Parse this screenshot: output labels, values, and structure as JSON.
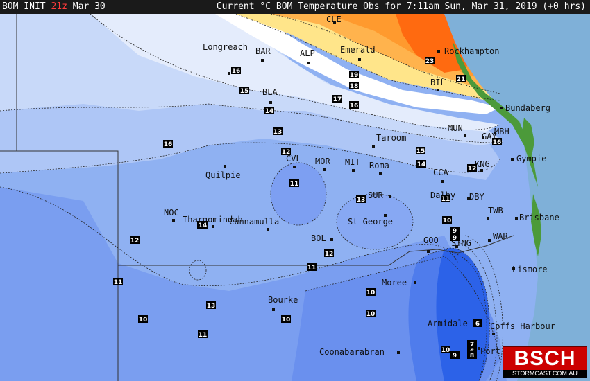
{
  "header": {
    "init_prefix": "BOM INIT",
    "init_time": "21z",
    "init_date": "Mar 30",
    "title": "Current °C BOM Temperature Obs for 7:11am Sun, Mar 31, 2019 (+0 hrs)"
  },
  "logo": {
    "name": "BSCH",
    "url": "STORMCAST.COM.AU"
  },
  "colors": {
    "ocean": "#7fb0d8",
    "land_green": "#4c9a3a",
    "warm_orange": "#ff7a1a",
    "cold_blue": "#2c62e8"
  },
  "towns": [
    {
      "name": "Longreach"
    },
    {
      "name": "BAR"
    },
    {
      "name": "ALP"
    },
    {
      "name": "CLE"
    },
    {
      "name": "Emerald"
    },
    {
      "name": "Rockhampton"
    },
    {
      "name": "BIL"
    },
    {
      "name": "BLA"
    },
    {
      "name": "Bundaberg"
    },
    {
      "name": "Taroom"
    },
    {
      "name": "MUN"
    },
    {
      "name": "GAY"
    },
    {
      "name": "MBH"
    },
    {
      "name": "Gympie"
    },
    {
      "name": "Quilpie"
    },
    {
      "name": "CVL"
    },
    {
      "name": "MOR"
    },
    {
      "name": "MIT"
    },
    {
      "name": "Roma"
    },
    {
      "name": "CCA"
    },
    {
      "name": "KNG"
    },
    {
      "name": "SUR"
    },
    {
      "name": "Dalby"
    },
    {
      "name": "DBY"
    },
    {
      "name": "NOC"
    },
    {
      "name": "Thargomindah"
    },
    {
      "name": "Cunnamulla"
    },
    {
      "name": "St George"
    },
    {
      "name": "TWB"
    },
    {
      "name": "Brisbane"
    },
    {
      "name": "BOL"
    },
    {
      "name": "GOO"
    },
    {
      "name": "STNG"
    },
    {
      "name": "WAR"
    },
    {
      "name": "Lismore"
    },
    {
      "name": "Moree"
    },
    {
      "name": "Bourke"
    },
    {
      "name": "Armidale"
    },
    {
      "name": "Coffs Harbour"
    },
    {
      "name": "Coonabarabran"
    },
    {
      "name": "Port"
    }
  ],
  "contour_labels": [
    "16",
    "15",
    "16",
    "14",
    "13",
    "12",
    "11",
    "13",
    "12",
    "11",
    "11",
    "13",
    "10",
    "11",
    "10",
    "10",
    "10",
    "12",
    "14",
    "19",
    "18",
    "17",
    "16",
    "23",
    "21",
    "15",
    "14",
    "12",
    "16",
    "11",
    "10",
    "9",
    "9",
    "7",
    "6",
    "6",
    "8",
    "9",
    "10",
    "14"
  ]
}
